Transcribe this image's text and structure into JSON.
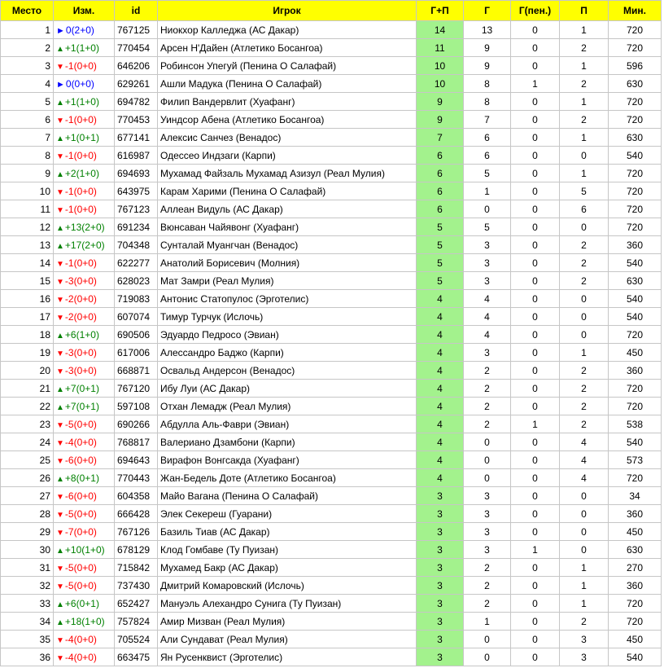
{
  "headers": [
    "Место",
    "Изм.",
    "id",
    "Игрок",
    "Г+П",
    "Г",
    "Г(пен.)",
    "П",
    "Мин."
  ],
  "colors": {
    "header": "#ffff00",
    "gp_cell": "#a3f28d",
    "up": "#008000",
    "down": "#ff0000",
    "same": "#0000ff"
  },
  "arrow_icons": {
    "up": "▲",
    "down": "▼",
    "same": "►"
  },
  "rows": [
    {
      "place": "1",
      "dir": "same",
      "change": "0(2+0)",
      "id": "767125",
      "player": "Ниокхор Калледжа (АС Дакар)",
      "gp": "14",
      "g": "13",
      "gpen": "0",
      "p": "1",
      "min": "720"
    },
    {
      "place": "2",
      "dir": "up",
      "change": "+1(1+0)",
      "id": "770454",
      "player": "Арсен Н'Дайен (Атлетико Босангоа)",
      "gp": "11",
      "g": "9",
      "gpen": "0",
      "p": "2",
      "min": "720"
    },
    {
      "place": "3",
      "dir": "down",
      "change": "-1(0+0)",
      "id": "646206",
      "player": "Робинсон Упегуй (Пенина О Салафай)",
      "gp": "10",
      "g": "9",
      "gpen": "0",
      "p": "1",
      "min": "596"
    },
    {
      "place": "4",
      "dir": "same",
      "change": "0(0+0)",
      "id": "629261",
      "player": "Ашли Мадука (Пенина О Салафай)",
      "gp": "10",
      "g": "8",
      "gpen": "1",
      "p": "2",
      "min": "630"
    },
    {
      "place": "5",
      "dir": "up",
      "change": "+1(1+0)",
      "id": "694782",
      "player": "Филип Вандервлит (Хуафанг)",
      "gp": "9",
      "g": "8",
      "gpen": "0",
      "p": "1",
      "min": "720"
    },
    {
      "place": "6",
      "dir": "down",
      "change": "-1(0+0)",
      "id": "770453",
      "player": "Уиндсор Абена (Атлетико Босангоа)",
      "gp": "9",
      "g": "7",
      "gpen": "0",
      "p": "2",
      "min": "720"
    },
    {
      "place": "7",
      "dir": "up",
      "change": "+1(0+1)",
      "id": "677141",
      "player": "Алексис Санчез (Венадос)",
      "gp": "7",
      "g": "6",
      "gpen": "0",
      "p": "1",
      "min": "630"
    },
    {
      "place": "8",
      "dir": "down",
      "change": "-1(0+0)",
      "id": "616987",
      "player": "Одессео Индзаги (Карпи)",
      "gp": "6",
      "g": "6",
      "gpen": "0",
      "p": "0",
      "min": "540"
    },
    {
      "place": "9",
      "dir": "up",
      "change": "+2(1+0)",
      "id": "694693",
      "player": "Мухамад Файзаль Мухамад Азизул (Реал Мулия)",
      "gp": "6",
      "g": "5",
      "gpen": "0",
      "p": "1",
      "min": "720"
    },
    {
      "place": "10",
      "dir": "down",
      "change": "-1(0+0)",
      "id": "643975",
      "player": "Карам Харими (Пенина О Салафай)",
      "gp": "6",
      "g": "1",
      "gpen": "0",
      "p": "5",
      "min": "720"
    },
    {
      "place": "11",
      "dir": "down",
      "change": "-1(0+0)",
      "id": "767123",
      "player": "Аллеан Видуль (АС Дакар)",
      "gp": "6",
      "g": "0",
      "gpen": "0",
      "p": "6",
      "min": "720"
    },
    {
      "place": "12",
      "dir": "up",
      "change": "+13(2+0)",
      "id": "691234",
      "player": "Вюнсаван Чайявонг (Хуафанг)",
      "gp": "5",
      "g": "5",
      "gpen": "0",
      "p": "0",
      "min": "720"
    },
    {
      "place": "13",
      "dir": "up",
      "change": "+17(2+0)",
      "id": "704348",
      "player": "Сунталай Муангчан (Венадос)",
      "gp": "5",
      "g": "3",
      "gpen": "0",
      "p": "2",
      "min": "360"
    },
    {
      "place": "14",
      "dir": "down",
      "change": "-1(0+0)",
      "id": "622277",
      "player": "Анатолий Борисевич (Молния)",
      "gp": "5",
      "g": "3",
      "gpen": "0",
      "p": "2",
      "min": "540"
    },
    {
      "place": "15",
      "dir": "down",
      "change": "-3(0+0)",
      "id": "628023",
      "player": "Мат Замри (Реал Мулия)",
      "gp": "5",
      "g": "3",
      "gpen": "0",
      "p": "2",
      "min": "630"
    },
    {
      "place": "16",
      "dir": "down",
      "change": "-2(0+0)",
      "id": "719083",
      "player": "Антонис Статопулос (Эрготелис)",
      "gp": "4",
      "g": "4",
      "gpen": "0",
      "p": "0",
      "min": "540"
    },
    {
      "place": "17",
      "dir": "down",
      "change": "-2(0+0)",
      "id": "607074",
      "player": "Тимур Турчук (Ислочь)",
      "gp": "4",
      "g": "4",
      "gpen": "0",
      "p": "0",
      "min": "540"
    },
    {
      "place": "18",
      "dir": "up",
      "change": "+6(1+0)",
      "id": "690506",
      "player": "Эдуардо Педросо (Эвиан)",
      "gp": "4",
      "g": "4",
      "gpen": "0",
      "p": "0",
      "min": "720"
    },
    {
      "place": "19",
      "dir": "down",
      "change": "-3(0+0)",
      "id": "617006",
      "player": "Алессандро Баджо (Карпи)",
      "gp": "4",
      "g": "3",
      "gpen": "0",
      "p": "1",
      "min": "450"
    },
    {
      "place": "20",
      "dir": "down",
      "change": "-3(0+0)",
      "id": "668871",
      "player": "Освальд Андерсон (Венадос)",
      "gp": "4",
      "g": "2",
      "gpen": "0",
      "p": "2",
      "min": "360"
    },
    {
      "place": "21",
      "dir": "up",
      "change": "+7(0+1)",
      "id": "767120",
      "player": "Ибу Луи (АС Дакар)",
      "gp": "4",
      "g": "2",
      "gpen": "0",
      "p": "2",
      "min": "720"
    },
    {
      "place": "22",
      "dir": "up",
      "change": "+7(0+1)",
      "id": "597108",
      "player": "Отхан Лемадж (Реал Мулия)",
      "gp": "4",
      "g": "2",
      "gpen": "0",
      "p": "2",
      "min": "720"
    },
    {
      "place": "23",
      "dir": "down",
      "change": "-5(0+0)",
      "id": "690266",
      "player": "Абдулла Аль-Фаври (Эвиан)",
      "gp": "4",
      "g": "2",
      "gpen": "1",
      "p": "2",
      "min": "538"
    },
    {
      "place": "24",
      "dir": "down",
      "change": "-4(0+0)",
      "id": "768817",
      "player": "Валериано Дзамбони (Карпи)",
      "gp": "4",
      "g": "0",
      "gpen": "0",
      "p": "4",
      "min": "540"
    },
    {
      "place": "25",
      "dir": "down",
      "change": "-6(0+0)",
      "id": "694643",
      "player": "Вирафон Вонгсакда (Хуафанг)",
      "gp": "4",
      "g": "0",
      "gpen": "0",
      "p": "4",
      "min": "573"
    },
    {
      "place": "26",
      "dir": "up",
      "change": "+8(0+1)",
      "id": "770443",
      "player": "Жан-Бедель Доте (Атлетико Босангоа)",
      "gp": "4",
      "g": "0",
      "gpen": "0",
      "p": "4",
      "min": "720"
    },
    {
      "place": "27",
      "dir": "down",
      "change": "-6(0+0)",
      "id": "604358",
      "player": "Майо Вагана (Пенина О Салафай)",
      "gp": "3",
      "g": "3",
      "gpen": "0",
      "p": "0",
      "min": "34"
    },
    {
      "place": "28",
      "dir": "down",
      "change": "-5(0+0)",
      "id": "666428",
      "player": "Элек Секереш (Гуарани)",
      "gp": "3",
      "g": "3",
      "gpen": "0",
      "p": "0",
      "min": "360"
    },
    {
      "place": "29",
      "dir": "down",
      "change": "-7(0+0)",
      "id": "767126",
      "player": "Базиль Тиав (АС Дакар)",
      "gp": "3",
      "g": "3",
      "gpen": "0",
      "p": "0",
      "min": "450"
    },
    {
      "place": "30",
      "dir": "up",
      "change": "+10(1+0)",
      "id": "678129",
      "player": "Клод Гомбаве (Ту Пуизан)",
      "gp": "3",
      "g": "3",
      "gpen": "1",
      "p": "0",
      "min": "630"
    },
    {
      "place": "31",
      "dir": "down",
      "change": "-5(0+0)",
      "id": "715842",
      "player": "Мухамед Бакр (АС Дакар)",
      "gp": "3",
      "g": "2",
      "gpen": "0",
      "p": "1",
      "min": "270"
    },
    {
      "place": "32",
      "dir": "down",
      "change": "-5(0+0)",
      "id": "737430",
      "player": "Дмитрий Комаровский (Ислочь)",
      "gp": "3",
      "g": "2",
      "gpen": "0",
      "p": "1",
      "min": "360"
    },
    {
      "place": "33",
      "dir": "up",
      "change": "+6(0+1)",
      "id": "652427",
      "player": "Мануэль Алехандро Сунига (Ту Пуизан)",
      "gp": "3",
      "g": "2",
      "gpen": "0",
      "p": "1",
      "min": "720"
    },
    {
      "place": "34",
      "dir": "up",
      "change": "+18(1+0)",
      "id": "757824",
      "player": "Амир Мизван (Реал Мулия)",
      "gp": "3",
      "g": "1",
      "gpen": "0",
      "p": "2",
      "min": "720"
    },
    {
      "place": "35",
      "dir": "down",
      "change": "-4(0+0)",
      "id": "705524",
      "player": "Али Сундават (Реал Мулия)",
      "gp": "3",
      "g": "0",
      "gpen": "0",
      "p": "3",
      "min": "450"
    },
    {
      "place": "36",
      "dir": "down",
      "change": "-4(0+0)",
      "id": "663475",
      "player": "Ян Русенквист (Эрготелис)",
      "gp": "3",
      "g": "0",
      "gpen": "0",
      "p": "3",
      "min": "540"
    }
  ]
}
